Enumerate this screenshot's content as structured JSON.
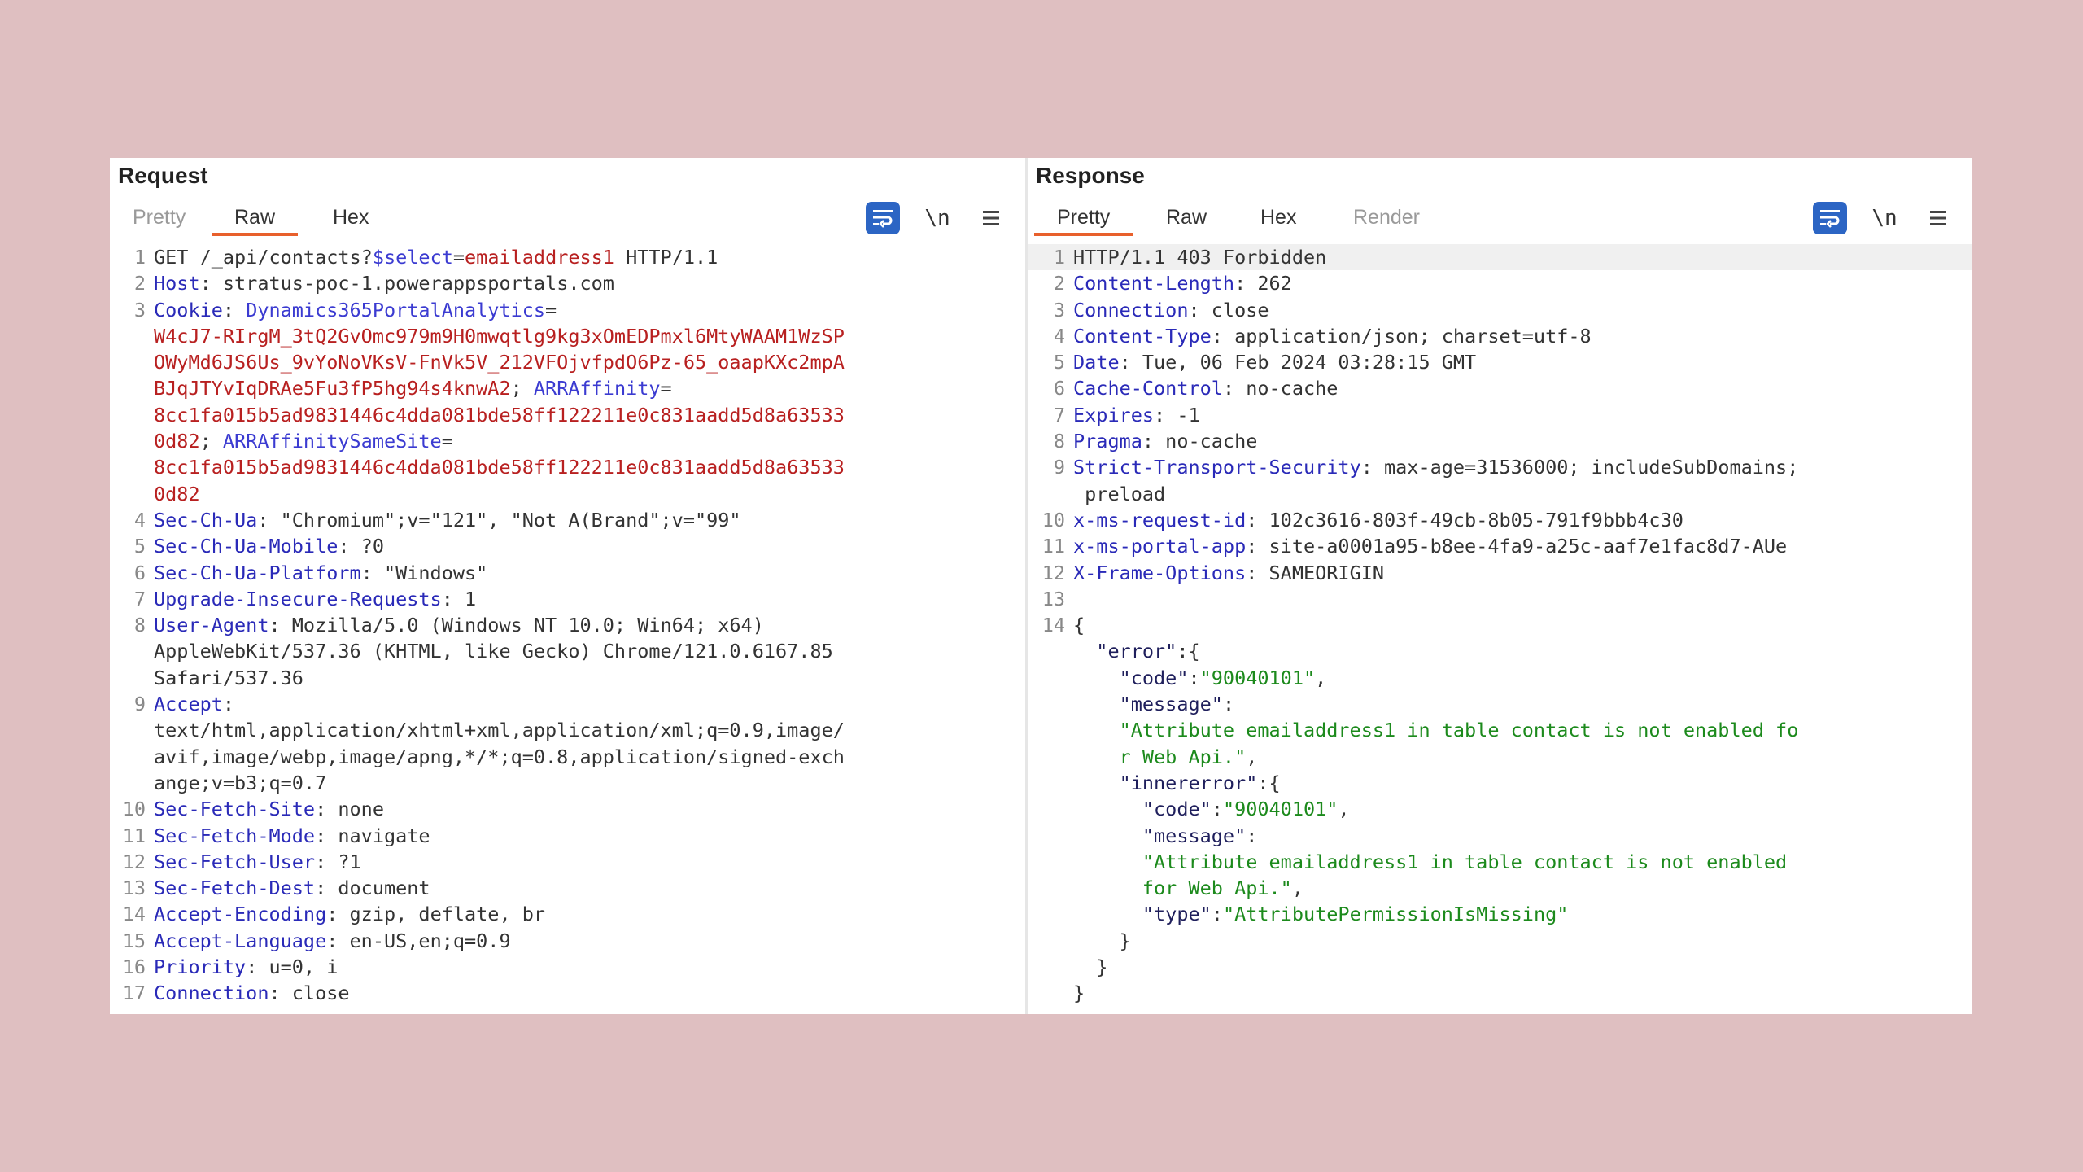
{
  "request": {
    "title": "Request",
    "tabs": [
      {
        "label": "Pretty"
      },
      {
        "label": "Raw"
      },
      {
        "label": "Hex"
      }
    ],
    "active_tab": "Raw",
    "newline_label": "\\n",
    "lines": [
      {
        "n": "1",
        "parts": [
          [
            "val",
            "GET /_api/contacts?"
          ],
          [
            "kp",
            "$select"
          ],
          [
            "val",
            "="
          ],
          [
            "red",
            "emailaddress1"
          ],
          [
            "val",
            " HTTP/1.1"
          ]
        ]
      },
      {
        "n": "2",
        "parts": [
          [
            "k",
            "Host"
          ],
          [
            "val",
            ": stratus-poc-1.powerappsportals.com"
          ]
        ]
      },
      {
        "n": "3",
        "parts": [
          [
            "k",
            "Cookie"
          ],
          [
            "val",
            ": "
          ],
          [
            "kp",
            "Dynamics365PortalAnalytics"
          ],
          [
            "val",
            "="
          ]
        ]
      },
      {
        "n": "",
        "parts": [
          [
            "red",
            "W4cJ7-RIrgM_3tQ2GvOmc979m9H0mwqtlg9kg3xOmEDPmxl6MtyWAAM1WzSP"
          ]
        ]
      },
      {
        "n": "",
        "parts": [
          [
            "red",
            "OWyMd6JS6Us_9vYoNoVKsV-FnVk5V_212VFOjvfpdO6Pz-65_oaapKXc2mpA"
          ]
        ]
      },
      {
        "n": "",
        "parts": [
          [
            "red",
            "BJqJTYvIqDRAe5Fu3fP5hg94s4knwA2"
          ],
          [
            "val",
            "; "
          ],
          [
            "kp",
            "ARRAffinity"
          ],
          [
            "val",
            "="
          ]
        ]
      },
      {
        "n": "",
        "parts": [
          [
            "red",
            "8cc1fa015b5ad9831446c4dda081bde58ff122211e0c831aadd5d8a63533"
          ]
        ]
      },
      {
        "n": "",
        "parts": [
          [
            "red",
            "0d82"
          ],
          [
            "val",
            "; "
          ],
          [
            "kp",
            "ARRAffinitySameSite"
          ],
          [
            "val",
            "="
          ]
        ]
      },
      {
        "n": "",
        "parts": [
          [
            "red",
            "8cc1fa015b5ad9831446c4dda081bde58ff122211e0c831aadd5d8a63533"
          ]
        ]
      },
      {
        "n": "",
        "parts": [
          [
            "red",
            "0d82"
          ]
        ]
      },
      {
        "n": "4",
        "parts": [
          [
            "k",
            "Sec-Ch-Ua"
          ],
          [
            "val",
            ": \"Chromium\";v=\"121\", \"Not A(Brand\";v=\"99\""
          ]
        ]
      },
      {
        "n": "5",
        "parts": [
          [
            "k",
            "Sec-Ch-Ua-Mobile"
          ],
          [
            "val",
            ": ?0"
          ]
        ]
      },
      {
        "n": "6",
        "parts": [
          [
            "k",
            "Sec-Ch-Ua-Platform"
          ],
          [
            "val",
            ": \"Windows\""
          ]
        ]
      },
      {
        "n": "7",
        "parts": [
          [
            "k",
            "Upgrade-Insecure-Requests"
          ],
          [
            "val",
            ": 1"
          ]
        ]
      },
      {
        "n": "8",
        "parts": [
          [
            "k",
            "User-Agent"
          ],
          [
            "val",
            ": Mozilla/5.0 (Windows NT 10.0; Win64; x64)"
          ]
        ]
      },
      {
        "n": "",
        "parts": [
          [
            "val",
            "AppleWebKit/537.36 (KHTML, like Gecko) Chrome/121.0.6167.85"
          ]
        ]
      },
      {
        "n": "",
        "parts": [
          [
            "val",
            "Safari/537.36"
          ]
        ]
      },
      {
        "n": "9",
        "parts": [
          [
            "k",
            "Accept"
          ],
          [
            "val",
            ":"
          ]
        ]
      },
      {
        "n": "",
        "parts": [
          [
            "val",
            "text/html,application/xhtml+xml,application/xml;q=0.9,image/"
          ]
        ]
      },
      {
        "n": "",
        "parts": [
          [
            "val",
            "avif,image/webp,image/apng,*/*;q=0.8,application/signed-exch"
          ]
        ]
      },
      {
        "n": "",
        "parts": [
          [
            "val",
            "ange;v=b3;q=0.7"
          ]
        ]
      },
      {
        "n": "10",
        "parts": [
          [
            "k",
            "Sec-Fetch-Site"
          ],
          [
            "val",
            ": none"
          ]
        ]
      },
      {
        "n": "11",
        "parts": [
          [
            "k",
            "Sec-Fetch-Mode"
          ],
          [
            "val",
            ": navigate"
          ]
        ]
      },
      {
        "n": "12",
        "parts": [
          [
            "k",
            "Sec-Fetch-User"
          ],
          [
            "val",
            ": ?1"
          ]
        ]
      },
      {
        "n": "13",
        "parts": [
          [
            "k",
            "Sec-Fetch-Dest"
          ],
          [
            "val",
            ": document"
          ]
        ]
      },
      {
        "n": "14",
        "parts": [
          [
            "k",
            "Accept-Encoding"
          ],
          [
            "val",
            ": gzip, deflate, br"
          ]
        ]
      },
      {
        "n": "15",
        "parts": [
          [
            "k",
            "Accept-Language"
          ],
          [
            "val",
            ": en-US,en;q=0.9"
          ]
        ]
      },
      {
        "n": "16",
        "parts": [
          [
            "k",
            "Priority"
          ],
          [
            "val",
            ": u=0, i"
          ]
        ]
      },
      {
        "n": "17",
        "parts": [
          [
            "k",
            "Connection"
          ],
          [
            "val",
            ": close"
          ]
        ]
      }
    ]
  },
  "response": {
    "title": "Response",
    "tabs": [
      {
        "label": "Pretty"
      },
      {
        "label": "Raw"
      },
      {
        "label": "Hex"
      },
      {
        "label": "Render"
      }
    ],
    "active_tab": "Pretty",
    "newline_label": "\\n",
    "lines": [
      {
        "n": "1",
        "hl": true,
        "parts": [
          [
            "val",
            "HTTP/1.1 403 Forbidden"
          ]
        ]
      },
      {
        "n": "2",
        "parts": [
          [
            "k",
            "Content-Length"
          ],
          [
            "val",
            ": 262"
          ]
        ]
      },
      {
        "n": "3",
        "parts": [
          [
            "k",
            "Connection"
          ],
          [
            "val",
            ": close"
          ]
        ]
      },
      {
        "n": "4",
        "parts": [
          [
            "k",
            "Content-Type"
          ],
          [
            "val",
            ": application/json; charset=utf-8"
          ]
        ]
      },
      {
        "n": "5",
        "parts": [
          [
            "k",
            "Date"
          ],
          [
            "val",
            ": Tue, 06 Feb 2024 03:28:15 GMT"
          ]
        ]
      },
      {
        "n": "6",
        "parts": [
          [
            "k",
            "Cache-Control"
          ],
          [
            "val",
            ": no-cache"
          ]
        ]
      },
      {
        "n": "7",
        "parts": [
          [
            "k",
            "Expires"
          ],
          [
            "val",
            ": -1"
          ]
        ]
      },
      {
        "n": "8",
        "parts": [
          [
            "k",
            "Pragma"
          ],
          [
            "val",
            ": no-cache"
          ]
        ]
      },
      {
        "n": "9",
        "parts": [
          [
            "k",
            "Strict-Transport-Security"
          ],
          [
            "val",
            ": max-age=31536000; includeSubDomains;"
          ]
        ]
      },
      {
        "n": "",
        "parts": [
          [
            "val",
            " preload"
          ]
        ]
      },
      {
        "n": "10",
        "parts": [
          [
            "k",
            "x-ms-request-id"
          ],
          [
            "val",
            ": 102c3616-803f-49cb-8b05-791f9bbb4c30"
          ]
        ]
      },
      {
        "n": "11",
        "parts": [
          [
            "k",
            "x-ms-portal-app"
          ],
          [
            "val",
            ": site-a0001a95-b8ee-4fa9-a25c-aaf7e1fac8d7-AUe"
          ]
        ]
      },
      {
        "n": "12",
        "parts": [
          [
            "k",
            "X-Frame-Options"
          ],
          [
            "val",
            ": SAMEORIGIN"
          ]
        ]
      },
      {
        "n": "13",
        "parts": [
          [
            "val",
            ""
          ]
        ]
      },
      {
        "n": "14",
        "parts": [
          [
            "val",
            "{"
          ]
        ]
      },
      {
        "n": "",
        "parts": [
          [
            "q",
            "  \"error\""
          ],
          [
            "val",
            ":{"
          ]
        ]
      },
      {
        "n": "",
        "parts": [
          [
            "q",
            "    \"code\""
          ],
          [
            "val",
            ":"
          ],
          [
            "g",
            "\"90040101\""
          ],
          [
            "val",
            ","
          ]
        ]
      },
      {
        "n": "",
        "parts": [
          [
            "q",
            "    \"message\""
          ],
          [
            "val",
            ":"
          ]
        ]
      },
      {
        "n": "",
        "parts": [
          [
            "g",
            "    \"Attribute emailaddress1 in table contact is not enabled fo"
          ]
        ]
      },
      {
        "n": "",
        "parts": [
          [
            "g",
            "    r Web Api.\""
          ],
          [
            "val",
            ","
          ]
        ]
      },
      {
        "n": "",
        "parts": [
          [
            "q",
            "    \"innererror\""
          ],
          [
            "val",
            ":{"
          ]
        ]
      },
      {
        "n": "",
        "parts": [
          [
            "q",
            "      \"code\""
          ],
          [
            "val",
            ":"
          ],
          [
            "g",
            "\"90040101\""
          ],
          [
            "val",
            ","
          ]
        ]
      },
      {
        "n": "",
        "parts": [
          [
            "q",
            "      \"message\""
          ],
          [
            "val",
            ":"
          ]
        ]
      },
      {
        "n": "",
        "parts": [
          [
            "g",
            "      \"Attribute emailaddress1 in table contact is not enabled"
          ]
        ]
      },
      {
        "n": "",
        "parts": [
          [
            "g",
            "      for Web Api.\""
          ],
          [
            "val",
            ","
          ]
        ]
      },
      {
        "n": "",
        "parts": [
          [
            "q",
            "      \"type\""
          ],
          [
            "val",
            ":"
          ],
          [
            "g",
            "\"AttributePermissionIsMissing\""
          ]
        ]
      },
      {
        "n": "",
        "parts": [
          [
            "val",
            "    }"
          ]
        ]
      },
      {
        "n": "",
        "parts": [
          [
            "val",
            "  }"
          ]
        ]
      },
      {
        "n": "",
        "parts": [
          [
            "val",
            "}"
          ]
        ]
      }
    ]
  }
}
